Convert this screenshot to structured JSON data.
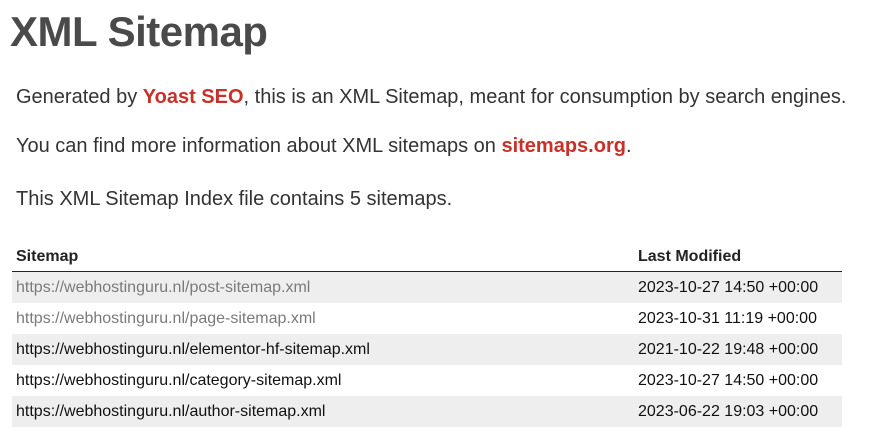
{
  "title": "XML Sitemap",
  "intro": {
    "prefix": "Generated by ",
    "generator_link": "Yoast SEO",
    "suffix": ", this is an XML Sitemap, meant for consumption by search engines."
  },
  "info": {
    "prefix": "You can find more information about XML sitemaps on ",
    "link": "sitemaps.org",
    "suffix": "."
  },
  "summary": "This XML Sitemap Index file contains 5 sitemaps.",
  "table": {
    "headers": {
      "sitemap": "Sitemap",
      "last_modified": "Last Modified"
    },
    "rows": [
      {
        "url": "https://webhostinguru.nl/post-sitemap.xml",
        "last_modified": "2023-10-27 14:50 +00:00"
      },
      {
        "url": "https://webhostinguru.nl/page-sitemap.xml",
        "last_modified": "2023-10-31 11:19 +00:00"
      },
      {
        "url": "https://webhostinguru.nl/elementor-hf-sitemap.xml",
        "last_modified": "2021-10-22 19:48 +00:00"
      },
      {
        "url": "https://webhostinguru.nl/category-sitemap.xml",
        "last_modified": "2023-10-27 14:50 +00:00"
      },
      {
        "url": "https://webhostinguru.nl/author-sitemap.xml",
        "last_modified": "2023-06-22 19:03 +00:00"
      }
    ]
  },
  "colors": {
    "link_accent": "#c7312a",
    "visited_link": "#7a7a7a",
    "row_shade": "#eeeeee"
  }
}
